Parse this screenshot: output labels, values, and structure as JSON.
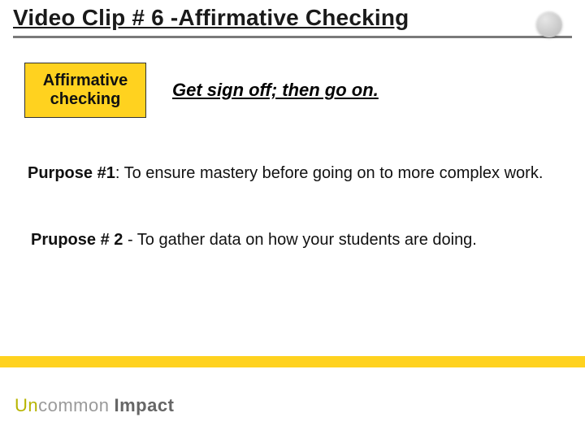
{
  "header": {
    "title": "Video Clip # 6 -Affirmative Checking"
  },
  "badge": {
    "line1": "Affirmative",
    "line2": "checking"
  },
  "tagline": "Get sign off; then go on.",
  "purpose1": {
    "label": "Purpose #1",
    "text": ": To ensure mastery before going on to more complex work."
  },
  "purpose2": {
    "label": "Prupose # 2",
    "text": "- To gather data on how your students are doing."
  },
  "logo": {
    "part1": "Un",
    "part2": "common",
    "part3": "Impact"
  }
}
